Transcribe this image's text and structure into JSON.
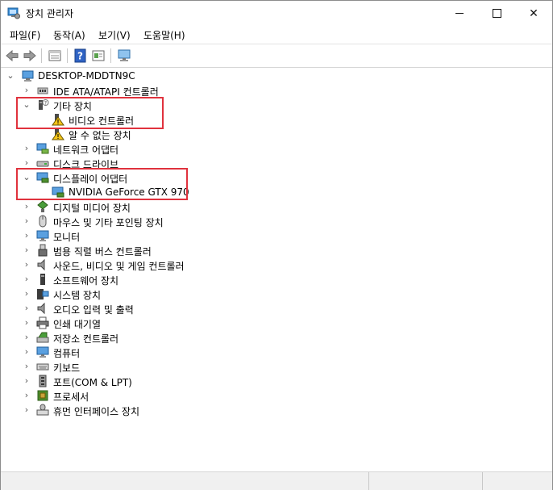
{
  "window": {
    "title": "장치 관리자",
    "controls": {
      "minimize": "minimize",
      "maximize": "maximize",
      "close": "✕"
    }
  },
  "menu": [
    "파일(F)",
    "동작(A)",
    "보기(V)",
    "도움말(H)"
  ],
  "toolbar": {
    "buttons": [
      "back-arrow-icon",
      "forward-arrow-icon",
      "properties-icon",
      "help-icon",
      "view-icon",
      "monitor-scan-icon"
    ]
  },
  "tree": {
    "root": "DESKTOP-MDDTN9C",
    "categories": [
      {
        "label": "IDE ATA/ATAPI 컨트롤러",
        "icon": "ide-controller-icon",
        "expanded": false
      },
      {
        "label": "기타 장치",
        "icon": "unknown-device-icon",
        "expanded": true,
        "children": [
          {
            "label": "비디오 컨트롤러",
            "icon": "warning-device-icon"
          },
          {
            "label": "알 수 없는 장치",
            "icon": "warning-device-icon"
          }
        ]
      },
      {
        "label": "네트워크 어댑터",
        "icon": "network-adapter-icon",
        "expanded": false
      },
      {
        "label": "디스크 드라이브",
        "icon": "disk-drive-icon",
        "expanded": false
      },
      {
        "label": "디스플레이 어댑터",
        "icon": "display-adapter-icon",
        "expanded": true,
        "children": [
          {
            "label": "NVIDIA GeForce GTX 970",
            "icon": "display-adapter-icon"
          }
        ]
      },
      {
        "label": "디지털 미디어 장치",
        "icon": "digital-media-icon",
        "expanded": false
      },
      {
        "label": "마우스 및 기타 포인팅 장치",
        "icon": "mouse-icon",
        "expanded": false
      },
      {
        "label": "모니터",
        "icon": "monitor-icon",
        "expanded": false
      },
      {
        "label": "범용 직렬 버스 컨트롤러",
        "icon": "usb-icon",
        "expanded": false
      },
      {
        "label": "사운드, 비디오 및 게임 컨트롤러",
        "icon": "speaker-icon",
        "expanded": false
      },
      {
        "label": "소프트웨어 장치",
        "icon": "software-device-icon",
        "expanded": false
      },
      {
        "label": "시스템 장치",
        "icon": "system-device-icon",
        "expanded": false
      },
      {
        "label": "오디오 입력 및 출력",
        "icon": "audio-icon",
        "expanded": false
      },
      {
        "label": "인쇄 대기열",
        "icon": "printer-icon",
        "expanded": false
      },
      {
        "label": "저장소 컨트롤러",
        "icon": "storage-controller-icon",
        "expanded": false
      },
      {
        "label": "컴퓨터",
        "icon": "computer-icon",
        "expanded": false
      },
      {
        "label": "키보드",
        "icon": "keyboard-icon",
        "expanded": false
      },
      {
        "label": "포트(COM & LPT)",
        "icon": "port-icon",
        "expanded": false
      },
      {
        "label": "프로세서",
        "icon": "processor-icon",
        "expanded": false
      },
      {
        "label": "휴먼 인터페이스 장치",
        "icon": "hid-icon",
        "expanded": false
      }
    ]
  },
  "colors": {
    "highlight": "#e0323d",
    "warning": "#f5c518",
    "icon_blue": "#2f7fd1"
  }
}
